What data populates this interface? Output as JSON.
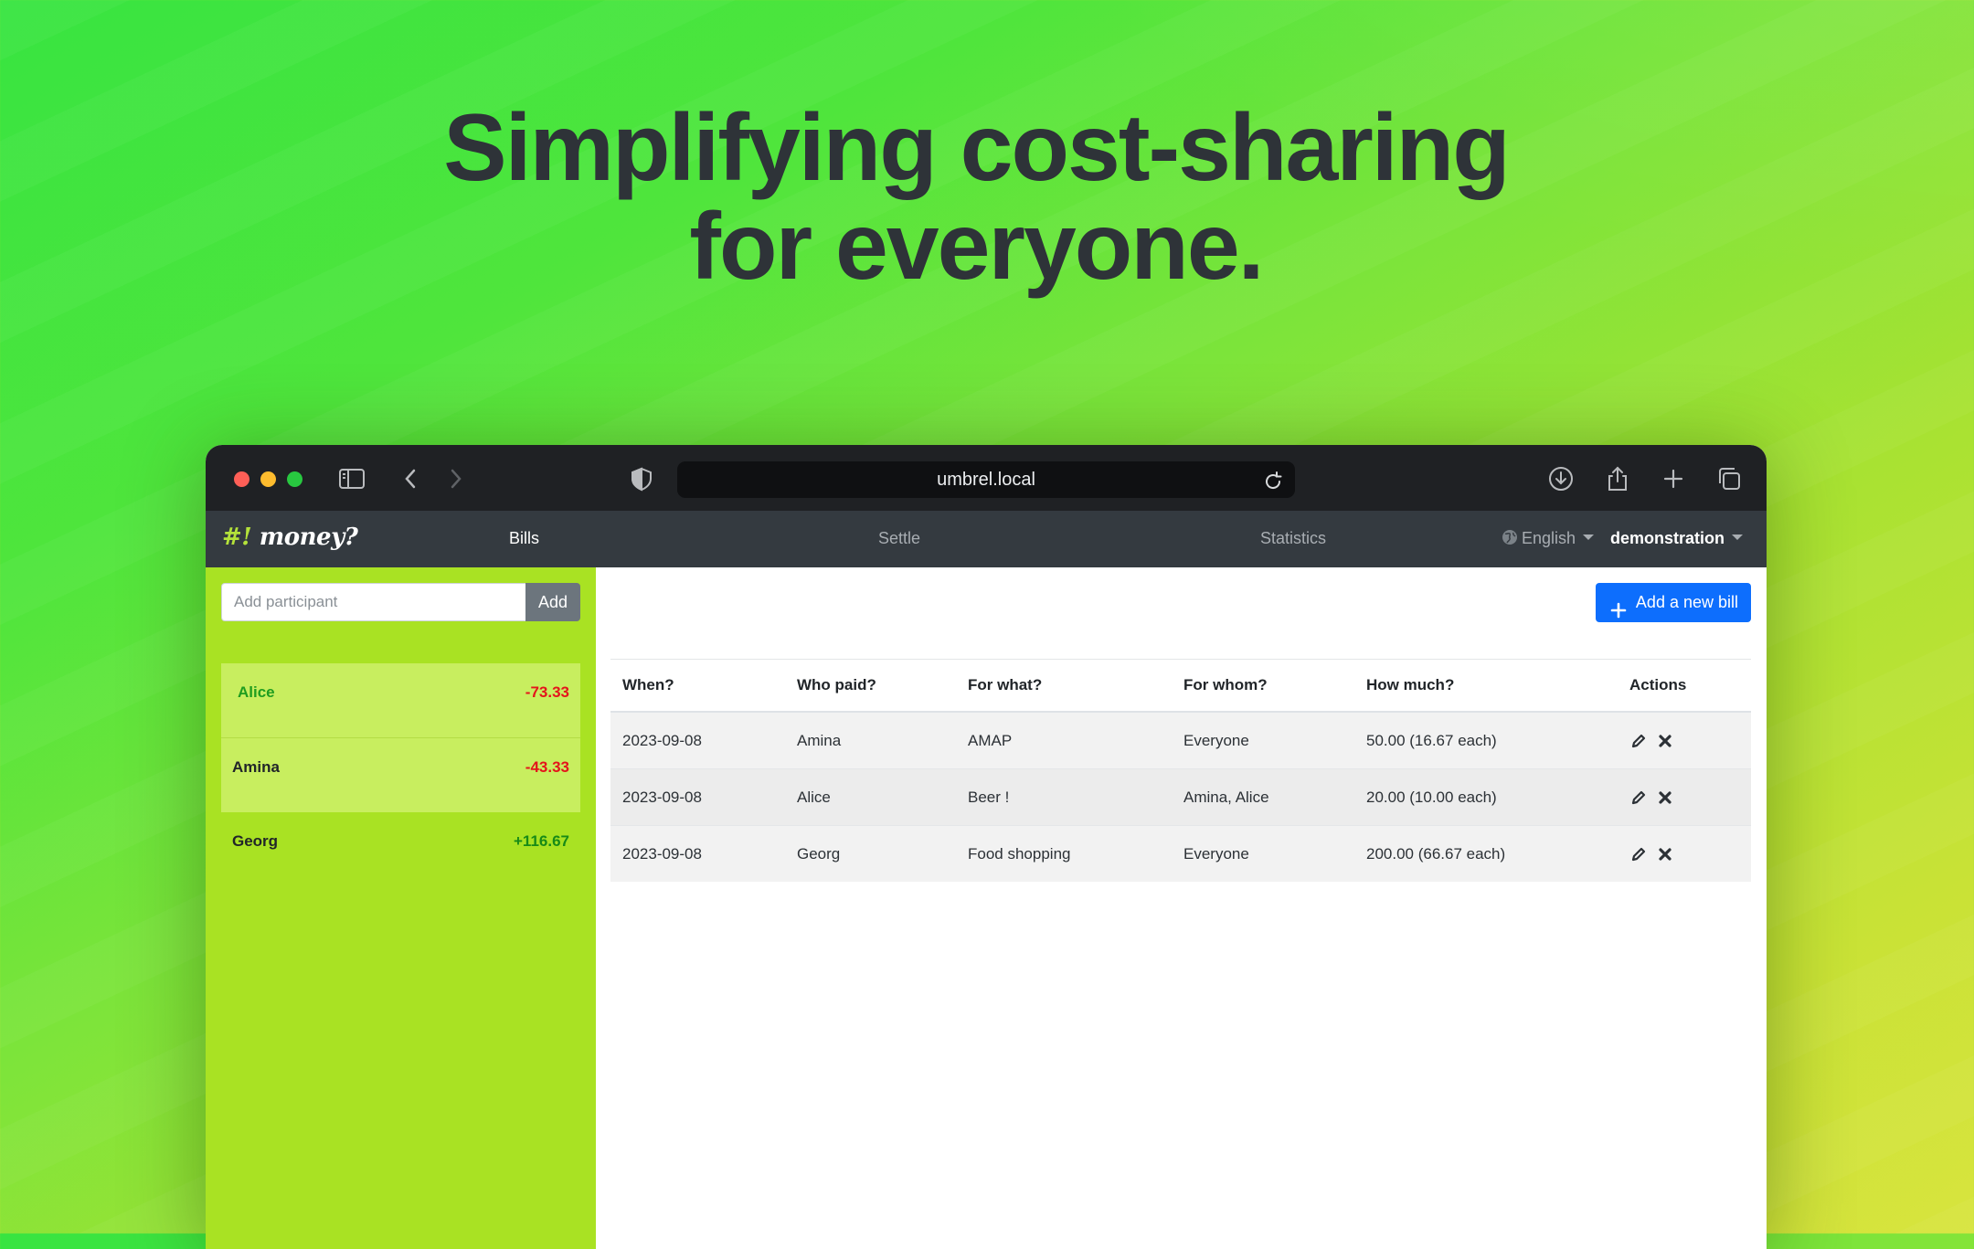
{
  "hero": {
    "line1": "Simplifying cost-sharing",
    "line2": "for everyone."
  },
  "browser": {
    "url": "umbrel.local"
  },
  "navbar": {
    "brand_hash": "#!",
    "brand_name": "money?",
    "links": {
      "bills": "Bills",
      "settle": "Settle",
      "statistics": "Statistics"
    },
    "language": "English",
    "project": "demonstration"
  },
  "sidebar": {
    "add_participant_placeholder": "Add participant",
    "add_button": "Add",
    "participants": [
      {
        "name": "Alice",
        "balance": "-73.33"
      },
      {
        "name": "Amina",
        "balance": "-43.33"
      },
      {
        "name": "Georg",
        "balance": "+116.67"
      }
    ]
  },
  "main": {
    "add_bill_label": "Add a new bill",
    "columns": {
      "when": "When?",
      "who_paid": "Who paid?",
      "for_what": "For what?",
      "for_whom": "For whom?",
      "how_much": "How much?",
      "actions": "Actions"
    },
    "bills": [
      {
        "when": "2023-09-08",
        "who_paid": "Amina",
        "for_what": "AMAP",
        "for_whom": "Everyone",
        "how_much": "50.00 (16.67 each)"
      },
      {
        "when": "2023-09-08",
        "who_paid": "Alice",
        "for_what": "Beer !",
        "for_whom": "Amina, Alice",
        "how_much": "20.00 (10.00 each)"
      },
      {
        "when": "2023-09-08",
        "who_paid": "Georg",
        "for_what": "Food shopping",
        "for_whom": "Everyone",
        "how_much": "200.00 (66.67 each)"
      }
    ]
  },
  "colors": {
    "negative": "#e4141b",
    "positive": "#178a17",
    "primary_button": "#0d6efd",
    "sidebar": "#a9e223",
    "navbar": "#343a40"
  }
}
